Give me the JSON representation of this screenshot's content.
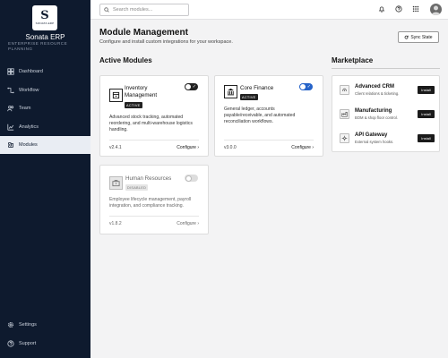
{
  "sidebar": {
    "logo_glyph": "S",
    "logo_word": "SONATA ERP",
    "brand": "Sonata ERP",
    "subtitle": "ENTERPRISE RESOURCE PLANNING",
    "items": [
      {
        "label": "Dashboard",
        "icon": "dashboard-icon"
      },
      {
        "label": "Workflow",
        "icon": "workflow-icon"
      },
      {
        "label": "Team",
        "icon": "team-icon"
      },
      {
        "label": "Analytics",
        "icon": "analytics-icon"
      },
      {
        "label": "Modules",
        "icon": "modules-icon",
        "active": true
      }
    ],
    "bottom_items": [
      {
        "label": "Settings",
        "icon": "gear-icon"
      },
      {
        "label": "Support",
        "icon": "help-icon"
      }
    ]
  },
  "topbar": {
    "search_placeholder": "Search modules...",
    "icons": [
      "bell-icon",
      "help-icon",
      "apps-grid-icon",
      "avatar"
    ]
  },
  "header": {
    "title": "Module Management",
    "subtitle": "Configure and install custom integrations for your workspace.",
    "sync_label": "Sync State"
  },
  "active_modules": {
    "title": "Active Modules",
    "cards": [
      {
        "title_line1": "Inventory",
        "title_line2": "Management",
        "badge": "ACTIVE",
        "enabled": true,
        "desc": [
          "Advanced stock tracking, automated",
          "reordering, and multi-warehouse logistics",
          "handling."
        ],
        "version": "v2.4.1",
        "configure": "Configure ›"
      },
      {
        "title_line1": "Core Finance",
        "badge": "ACTIVE",
        "enabled": true,
        "desc": [
          "General ledger, accounts",
          "payable/receivable, and automated",
          "reconciliation workflows."
        ],
        "version": "v3.0.0",
        "configure": "Configure ›"
      },
      {
        "title_line1": "Human Resources",
        "badge": "DISABLED",
        "enabled": false,
        "desc": [
          "Employee lifecycle management, payroll",
          "integration, and compliance tracking."
        ],
        "version": "v1.8.2",
        "configure": "Configure ›"
      }
    ]
  },
  "marketplace": {
    "title": "Marketplace",
    "items": [
      {
        "name": "Advanced CRM",
        "desc": "Client relations & ticketing.",
        "button": "Install"
      },
      {
        "name": "Manufacturing",
        "desc": "BOM & shop floor control.",
        "button": "Install"
      },
      {
        "name": "API Gateway",
        "desc": "External system hooks.",
        "button": "Install"
      }
    ]
  },
  "colors": {
    "sidebar_bg": "#0e1a2e",
    "toggle_blue": "#2563c9",
    "dark_button": "#1a1a1a"
  }
}
